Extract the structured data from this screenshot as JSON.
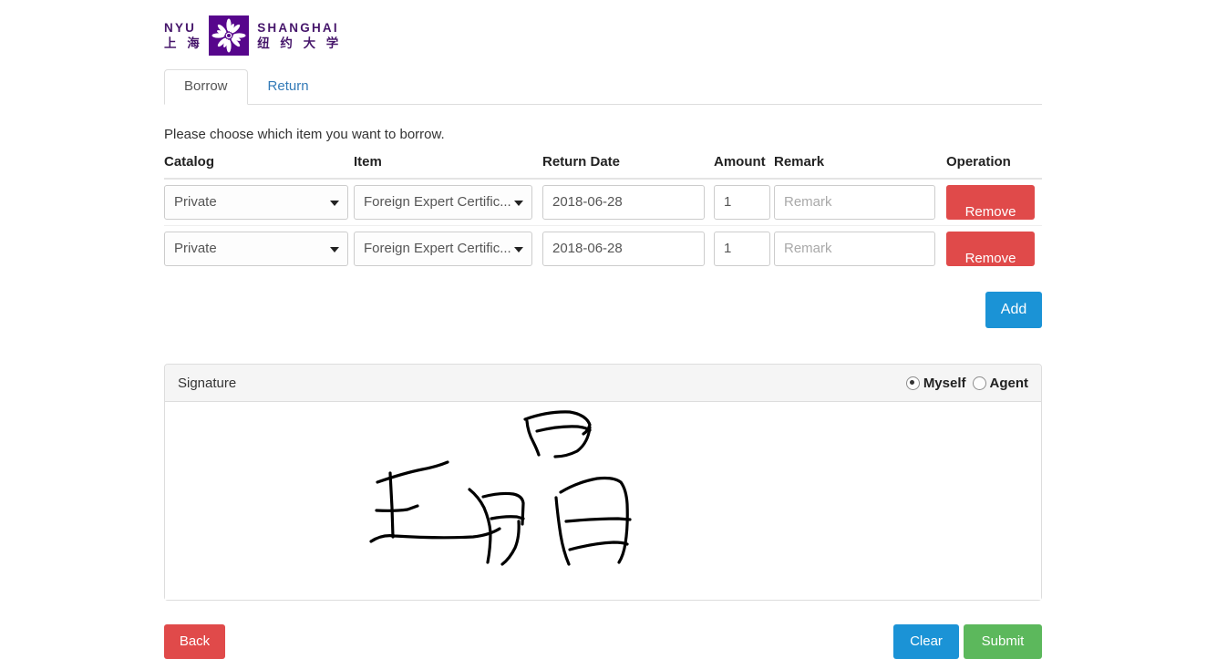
{
  "brand": {
    "en_top": "NYU",
    "cn_top": "上 海",
    "en_right": "SHANGHAI",
    "cn_right": "纽 约 大 学",
    "mark_color": "#57068c",
    "text_color": "#46166b",
    "logo_icon": "nyu-torch-emblem"
  },
  "tabs": [
    {
      "label": "Borrow",
      "active": true
    },
    {
      "label": "Return",
      "active": false
    }
  ],
  "instruction": "Please choose which item you want to borrow.",
  "table": {
    "headers": [
      "Catalog",
      "Item",
      "Return Date",
      "Amount",
      "Remark",
      "Operation"
    ],
    "rows": [
      {
        "catalog": "Private",
        "item": "Foreign Expert Certific...",
        "return_date": "2018-06-28",
        "amount": "1",
        "remark": "",
        "remark_placeholder": "Remark",
        "operation": "Remove"
      },
      {
        "catalog": "Private",
        "item": "Foreign Expert Certific...",
        "return_date": "2018-06-28",
        "amount": "1",
        "remark": "",
        "remark_placeholder": "Remark",
        "operation": "Remove"
      }
    ]
  },
  "add_button": "Add",
  "signature": {
    "title": "Signature",
    "options": [
      {
        "label": "Myself",
        "selected": true
      },
      {
        "label": "Agent",
        "selected": false
      }
    ]
  },
  "footer": {
    "back": "Back",
    "clear": "Clear",
    "submit": "Submit"
  },
  "colors": {
    "danger": "#e04a4a",
    "primary": "#1b93d6",
    "success": "#5cb85c",
    "link": "#337ab7"
  }
}
